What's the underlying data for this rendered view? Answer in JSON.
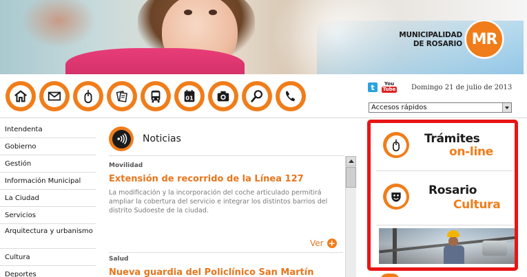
{
  "header": {
    "logo_line1": "MUNICIPALIDAD",
    "logo_line2": "DE ROSARIO",
    "logo_mark": "MR"
  },
  "toolbar": {
    "icons": [
      "home-icon",
      "mail-icon",
      "mouse-icon",
      "documents-icon",
      "bus-icon",
      "calendar-icon",
      "camera-icon",
      "search-icon",
      "phone-icon"
    ],
    "calendar_day": "01"
  },
  "social": {
    "twitter": "t",
    "youtube_top": "You",
    "youtube_bottom": "Tube"
  },
  "date_text": "Domingo 21 de julio de 2013",
  "quick_access": {
    "selected": "Accesos rápidos"
  },
  "sidebar": {
    "items": [
      {
        "label": "Intendenta"
      },
      {
        "label": "Gobierno"
      },
      {
        "label": "Gestión"
      },
      {
        "label": "Información Municipal"
      },
      {
        "label": "La Ciudad"
      },
      {
        "label": "Servicios"
      },
      {
        "label": "Arquitectura y urbanismo"
      },
      {
        "label": "Cultura"
      },
      {
        "label": "Deportes"
      }
    ]
  },
  "news": {
    "title": "Noticias",
    "articles": [
      {
        "category": "Movilidad",
        "headline": "Extensión de recorrido de la Línea 127",
        "summary": "La modificación y la incorporación del coche articulado permitirá ampliar la cobertura del servicio e integrar los distintos barrios del distrito Sudoeste de la ciudad.",
        "more": "Ver"
      },
      {
        "category": "Salud",
        "headline": "Nueva guardia del Policlínico San Martín"
      }
    ]
  },
  "promo": {
    "tramites_l1": "Trámites",
    "tramites_l2": "on-line",
    "cultura_l1": "Rosario",
    "cultura_l2": "Cultura"
  },
  "colors": {
    "accent": "#f07d1a",
    "highlight_border": "#e81515"
  }
}
